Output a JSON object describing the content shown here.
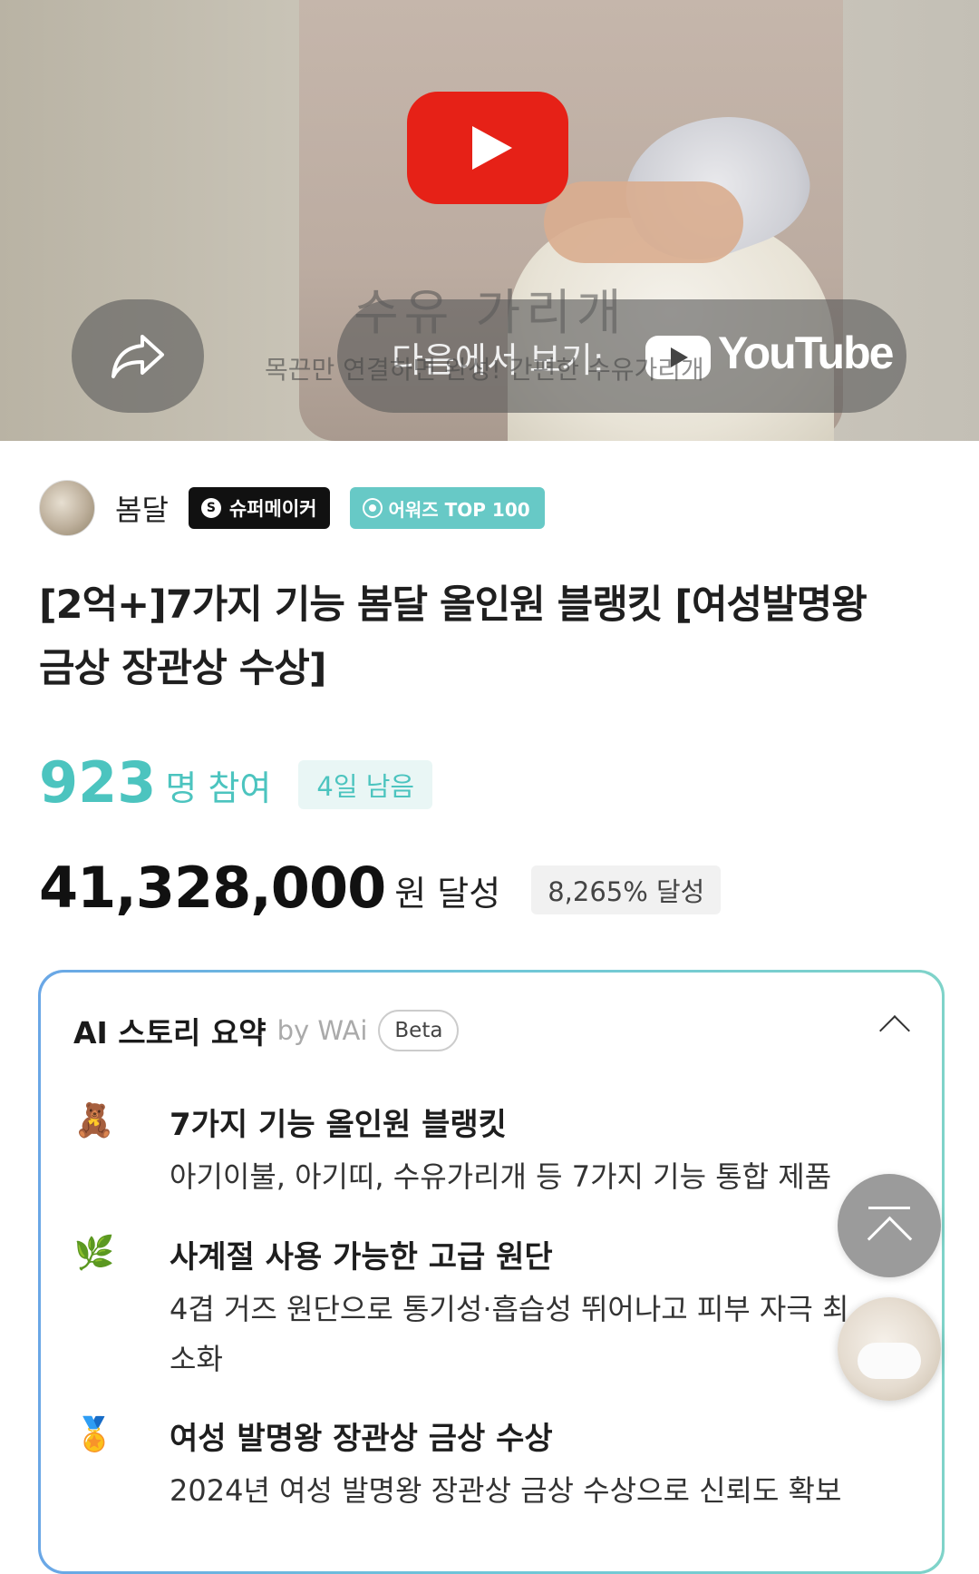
{
  "video": {
    "caption_big": "수유 가리개",
    "caption_small": "목끈만 연결하면 완성! 간편한 수유가리개",
    "watch_label": "다음에서 보기:",
    "youtube_word": "YouTube",
    "icons": [
      "youtube-play-icon",
      "share-icon",
      "youtube-logo-icon"
    ]
  },
  "creator": {
    "name": "봄달",
    "badge_super": "슈퍼메이커",
    "badge_awards": "어워즈 TOP 100"
  },
  "project": {
    "title": "[2억+]7가지 기능 봄달 올인원 블랭킷 [여성발명왕 금상 장관상 수상]",
    "participants": "923",
    "participants_unit": "명 참여",
    "days_left": "4일 남음",
    "amount": "41,328,000",
    "amount_unit": "원 달성",
    "percent": "8,265% 달성"
  },
  "ai_summary": {
    "title": "AI 스토리 요약",
    "by": "by WAi",
    "beta": "Beta",
    "items": [
      {
        "emoji": "🧸",
        "title": "7가지 기능 올인원 블랭킷",
        "desc": "아기이불, 아기띠, 수유가리개 등 7가지 기능 통합 제품"
      },
      {
        "emoji": "🌿",
        "title": "사계절 사용 가능한 고급 원단",
        "desc": "4겹 거즈 원단으로 통기성·흡습성 뛰어나고 피부 자극 최소화"
      },
      {
        "emoji": "🏅",
        "title": "여성 발명왕 장관상 금상 수상",
        "desc": "2024년 여성 발명왕 장관상 금상 수상으로 신뢰도 확보"
      }
    ]
  },
  "colors": {
    "accent_teal": "#4cc4bf",
    "youtube_red": "#e62117",
    "badge_black": "#111111",
    "badge_teal": "#67c9c6"
  }
}
